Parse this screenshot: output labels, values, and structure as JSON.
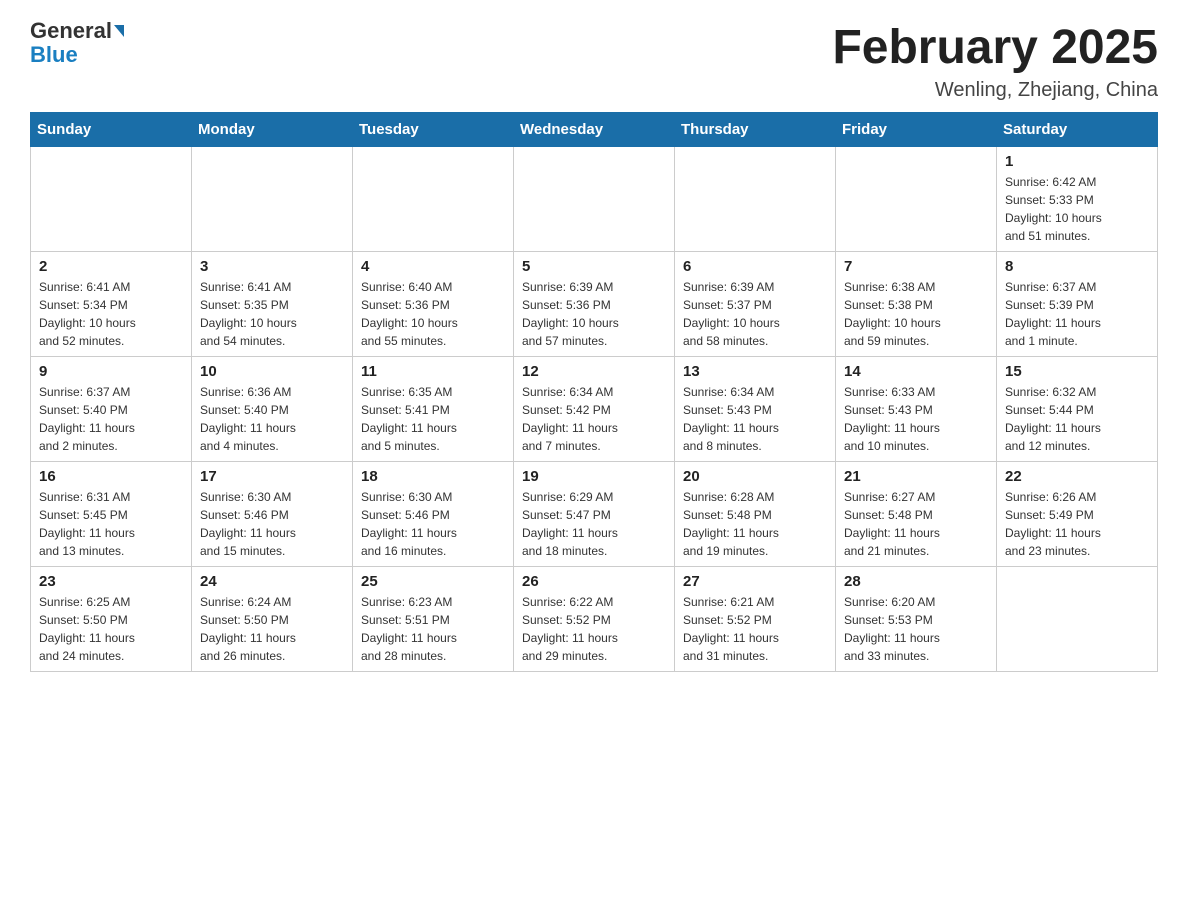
{
  "header": {
    "logo_general": "General",
    "logo_blue": "Blue",
    "main_title": "February 2025",
    "subtitle": "Wenling, Zhejiang, China"
  },
  "weekdays": [
    "Sunday",
    "Monday",
    "Tuesday",
    "Wednesday",
    "Thursday",
    "Friday",
    "Saturday"
  ],
  "weeks": [
    [
      {
        "day": "",
        "info": ""
      },
      {
        "day": "",
        "info": ""
      },
      {
        "day": "",
        "info": ""
      },
      {
        "day": "",
        "info": ""
      },
      {
        "day": "",
        "info": ""
      },
      {
        "day": "",
        "info": ""
      },
      {
        "day": "1",
        "info": "Sunrise: 6:42 AM\nSunset: 5:33 PM\nDaylight: 10 hours\nand 51 minutes."
      }
    ],
    [
      {
        "day": "2",
        "info": "Sunrise: 6:41 AM\nSunset: 5:34 PM\nDaylight: 10 hours\nand 52 minutes."
      },
      {
        "day": "3",
        "info": "Sunrise: 6:41 AM\nSunset: 5:35 PM\nDaylight: 10 hours\nand 54 minutes."
      },
      {
        "day": "4",
        "info": "Sunrise: 6:40 AM\nSunset: 5:36 PM\nDaylight: 10 hours\nand 55 minutes."
      },
      {
        "day": "5",
        "info": "Sunrise: 6:39 AM\nSunset: 5:36 PM\nDaylight: 10 hours\nand 57 minutes."
      },
      {
        "day": "6",
        "info": "Sunrise: 6:39 AM\nSunset: 5:37 PM\nDaylight: 10 hours\nand 58 minutes."
      },
      {
        "day": "7",
        "info": "Sunrise: 6:38 AM\nSunset: 5:38 PM\nDaylight: 10 hours\nand 59 minutes."
      },
      {
        "day": "8",
        "info": "Sunrise: 6:37 AM\nSunset: 5:39 PM\nDaylight: 11 hours\nand 1 minute."
      }
    ],
    [
      {
        "day": "9",
        "info": "Sunrise: 6:37 AM\nSunset: 5:40 PM\nDaylight: 11 hours\nand 2 minutes."
      },
      {
        "day": "10",
        "info": "Sunrise: 6:36 AM\nSunset: 5:40 PM\nDaylight: 11 hours\nand 4 minutes."
      },
      {
        "day": "11",
        "info": "Sunrise: 6:35 AM\nSunset: 5:41 PM\nDaylight: 11 hours\nand 5 minutes."
      },
      {
        "day": "12",
        "info": "Sunrise: 6:34 AM\nSunset: 5:42 PM\nDaylight: 11 hours\nand 7 minutes."
      },
      {
        "day": "13",
        "info": "Sunrise: 6:34 AM\nSunset: 5:43 PM\nDaylight: 11 hours\nand 8 minutes."
      },
      {
        "day": "14",
        "info": "Sunrise: 6:33 AM\nSunset: 5:43 PM\nDaylight: 11 hours\nand 10 minutes."
      },
      {
        "day": "15",
        "info": "Sunrise: 6:32 AM\nSunset: 5:44 PM\nDaylight: 11 hours\nand 12 minutes."
      }
    ],
    [
      {
        "day": "16",
        "info": "Sunrise: 6:31 AM\nSunset: 5:45 PM\nDaylight: 11 hours\nand 13 minutes."
      },
      {
        "day": "17",
        "info": "Sunrise: 6:30 AM\nSunset: 5:46 PM\nDaylight: 11 hours\nand 15 minutes."
      },
      {
        "day": "18",
        "info": "Sunrise: 6:30 AM\nSunset: 5:46 PM\nDaylight: 11 hours\nand 16 minutes."
      },
      {
        "day": "19",
        "info": "Sunrise: 6:29 AM\nSunset: 5:47 PM\nDaylight: 11 hours\nand 18 minutes."
      },
      {
        "day": "20",
        "info": "Sunrise: 6:28 AM\nSunset: 5:48 PM\nDaylight: 11 hours\nand 19 minutes."
      },
      {
        "day": "21",
        "info": "Sunrise: 6:27 AM\nSunset: 5:48 PM\nDaylight: 11 hours\nand 21 minutes."
      },
      {
        "day": "22",
        "info": "Sunrise: 6:26 AM\nSunset: 5:49 PM\nDaylight: 11 hours\nand 23 minutes."
      }
    ],
    [
      {
        "day": "23",
        "info": "Sunrise: 6:25 AM\nSunset: 5:50 PM\nDaylight: 11 hours\nand 24 minutes."
      },
      {
        "day": "24",
        "info": "Sunrise: 6:24 AM\nSunset: 5:50 PM\nDaylight: 11 hours\nand 26 minutes."
      },
      {
        "day": "25",
        "info": "Sunrise: 6:23 AM\nSunset: 5:51 PM\nDaylight: 11 hours\nand 28 minutes."
      },
      {
        "day": "26",
        "info": "Sunrise: 6:22 AM\nSunset: 5:52 PM\nDaylight: 11 hours\nand 29 minutes."
      },
      {
        "day": "27",
        "info": "Sunrise: 6:21 AM\nSunset: 5:52 PM\nDaylight: 11 hours\nand 31 minutes."
      },
      {
        "day": "28",
        "info": "Sunrise: 6:20 AM\nSunset: 5:53 PM\nDaylight: 11 hours\nand 33 minutes."
      },
      {
        "day": "",
        "info": ""
      }
    ]
  ]
}
